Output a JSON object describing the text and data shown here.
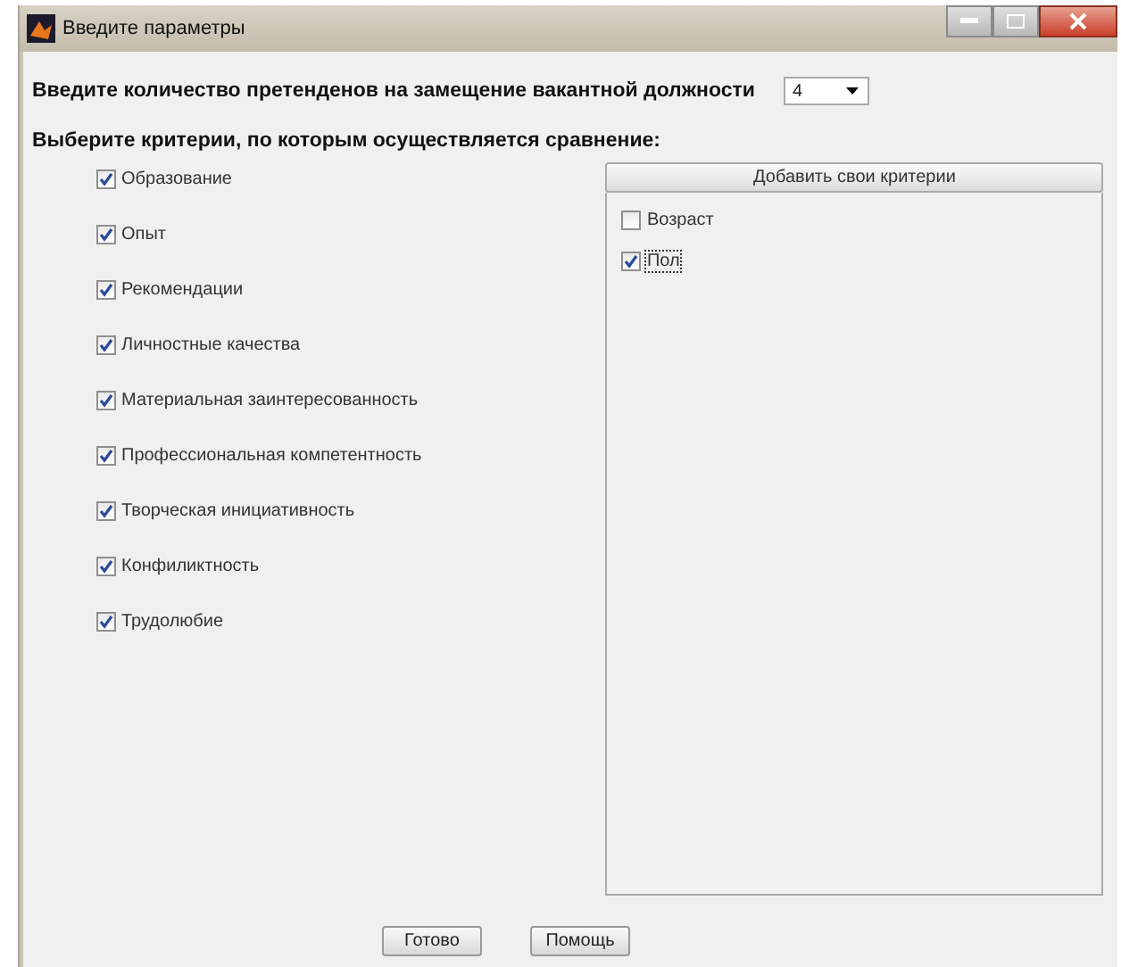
{
  "window": {
    "title": "Введите параметры"
  },
  "count": {
    "label": "Введите количество претенденов на замещение вакантной должности",
    "value": "4"
  },
  "criteria_label": "Выберите критерии, по которым осуществляется сравнение:",
  "criteria": [
    {
      "label": "Образование",
      "checked": true
    },
    {
      "label": "Опыт",
      "checked": true
    },
    {
      "label": "Рекомендации",
      "checked": true
    },
    {
      "label": "Личностные качества",
      "checked": true
    },
    {
      "label": "Материальная заинтересованность",
      "checked": true
    },
    {
      "label": "Профессиональная компетентность",
      "checked": true
    },
    {
      "label": "Творческая инициативность",
      "checked": true
    },
    {
      "label": "Конфиликтность",
      "checked": true
    },
    {
      "label": "Трудолюбие",
      "checked": true
    }
  ],
  "custom": {
    "button": "Добавить свои критерии",
    "items": [
      {
        "label": "Возраст",
        "checked": false,
        "focused": false
      },
      {
        "label": "Пол",
        "checked": true,
        "focused": true
      }
    ]
  },
  "buttons": [
    "Готово",
    "Помощь"
  ]
}
